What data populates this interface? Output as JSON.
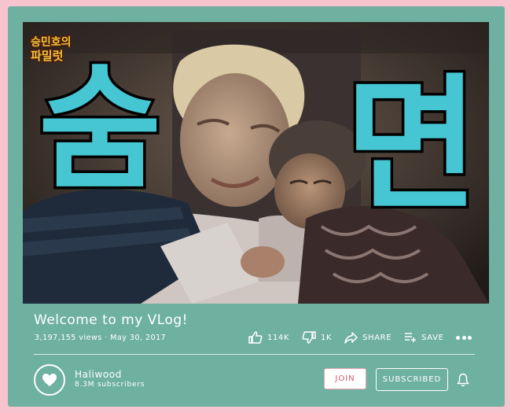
{
  "video": {
    "thumbnail_text_left": "숨",
    "thumbnail_text_right": "면",
    "logo_line1": "승민호의",
    "logo_line2": "파밀럿"
  },
  "title": "Welcome to my VLog!",
  "meta": {
    "views": "3,197,155 views",
    "separator": " · ",
    "date": "May 30, 2017"
  },
  "actions": {
    "like_count": "114K",
    "dislike_count": "1K",
    "share_label": "SHARE",
    "save_label": "SAVE"
  },
  "channel": {
    "name": "Haliwood",
    "subscribers": "8.3M subscribers"
  },
  "buttons": {
    "join_label": "JOIN",
    "subscribed_label": "SUBSCRIBED"
  },
  "colors": {
    "page_background": "#f6c3cf",
    "card_background": "#6fb1a1",
    "join_text": "#d15a72",
    "thumbnail_text": "#45c6d2"
  }
}
